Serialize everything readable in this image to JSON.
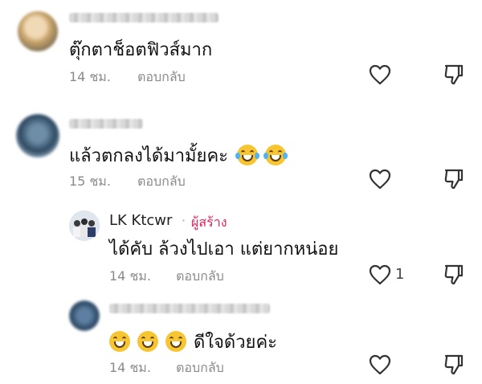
{
  "comments": [
    {
      "text": "ตุ๊กตาช็อตฟิวส์มาก",
      "time": "14 ชม.",
      "reply_label": "ตอบกลับ"
    },
    {
      "text": "แล้วตกลงได้มามั้ยคะ",
      "emoji": "face-with-tears-of-joy x2",
      "time": "15 ชม.",
      "reply_label": "ตอบกลับ"
    }
  ],
  "replies": [
    {
      "author": "LK Ktcwr",
      "separator": "·",
      "badge": "ผู้สร้าง",
      "text": "ได้คับ ล้วงไปเอา แต่ยากหน่อย",
      "time": "14 ชม.",
      "reply_label": "ตอบกลับ",
      "like_count": "1"
    },
    {
      "emoji": "grinning-face x3",
      "text": "ดีใจด้วยค่ะ",
      "time": "14 ชม.",
      "reply_label": "ตอบกลับ"
    }
  ],
  "icons": {
    "like": "heart-outline-icon",
    "dislike": "thumbs-down-outline-icon"
  },
  "colors": {
    "creator_badge": "#e0245e",
    "meta_text": "#8a8a8a"
  }
}
